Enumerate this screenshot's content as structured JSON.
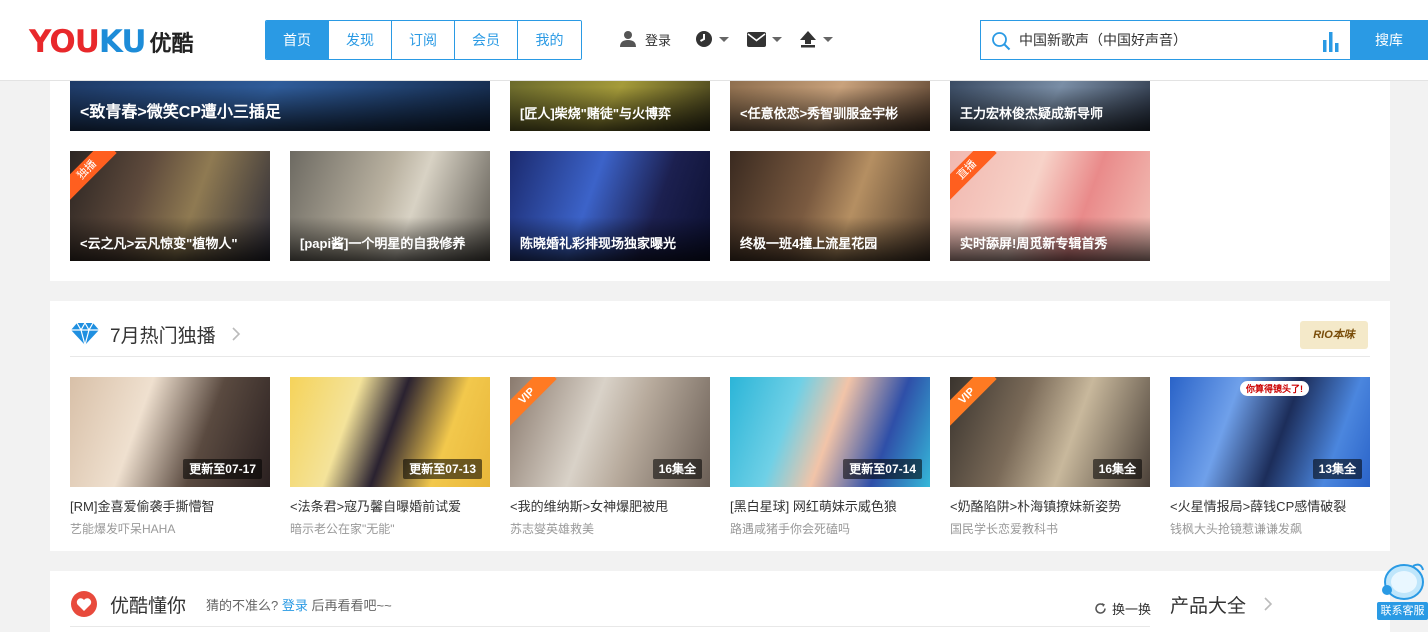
{
  "header": {
    "logo_en_a": "YOU",
    "logo_en_b": "KU",
    "logo_cn": "优酷",
    "nav_tabs": [
      {
        "label": "首页",
        "active": true
      },
      {
        "label": "发现"
      },
      {
        "label": "订阅"
      },
      {
        "label": "会员"
      },
      {
        "label": "我的"
      }
    ],
    "login_label": "登录",
    "search_value": "中国新歌声（中国好声音）",
    "search_button": "搜库"
  },
  "top_row_1": [
    {
      "title": "<致青春>微笑CP遭小三插足"
    },
    {
      "title": "[匠人]柴烧\"赌徒\"与火博弈"
    },
    {
      "title": "<任意依恋>秀智驯服金宇彬"
    },
    {
      "title": "王力宏林俊杰疑成新导师"
    }
  ],
  "top_row_2": [
    {
      "title": "<云之凡>云凡惊变\"植物人\"",
      "corner": "独播"
    },
    {
      "title": "[papi酱]一个明星的自我修养"
    },
    {
      "title": "陈晓婚礼彩排现场独家曝光"
    },
    {
      "title": "终极一班4撞上流星花园"
    },
    {
      "title": "实时舔屏!周觅新专辑首秀",
      "corner": "直播"
    }
  ],
  "july_section": {
    "title": "7月热门独播",
    "sponsor": "RIO本味",
    "cards": [
      {
        "badge": "更新至07-17",
        "title": "[RM]金喜爱偷袭手撕懵智",
        "sub": "艺能爆发吓呆HAHA"
      },
      {
        "badge": "更新至07-13",
        "title": "<法条君>寇乃馨自曝婚前试爱",
        "sub": "暗示老公在家\"无能\""
      },
      {
        "badge": "16集全",
        "title": "<我的维纳斯>女神爆肥被甩",
        "sub": "苏志燮英雄救美",
        "corner": "VIP"
      },
      {
        "badge": "更新至07-14",
        "title": "[黑白星球] 网红萌妹示威色狼",
        "sub": "路遇咸猪手你会死磕吗"
      },
      {
        "badge": "16集全",
        "title": "<奶酪陷阱>朴海镇撩妹新姿势",
        "sub": "国民学长恋爱教科书",
        "corner": "VIP"
      },
      {
        "badge": "13集全",
        "title": "<火星情报局>薛钱CP感情破裂",
        "sub": "钱枫大头抢镜惹谦谦发飙",
        "bubble": "你算得镜头了!"
      }
    ]
  },
  "dong_section": {
    "title": "优酷懂你",
    "guess_prefix": "猜的不准么?",
    "guess_link": "登录",
    "guess_suffix": "后再看看吧~~",
    "refresh_label": "换一换",
    "products_title": "产品大全"
  },
  "service_label": "联系客服"
}
